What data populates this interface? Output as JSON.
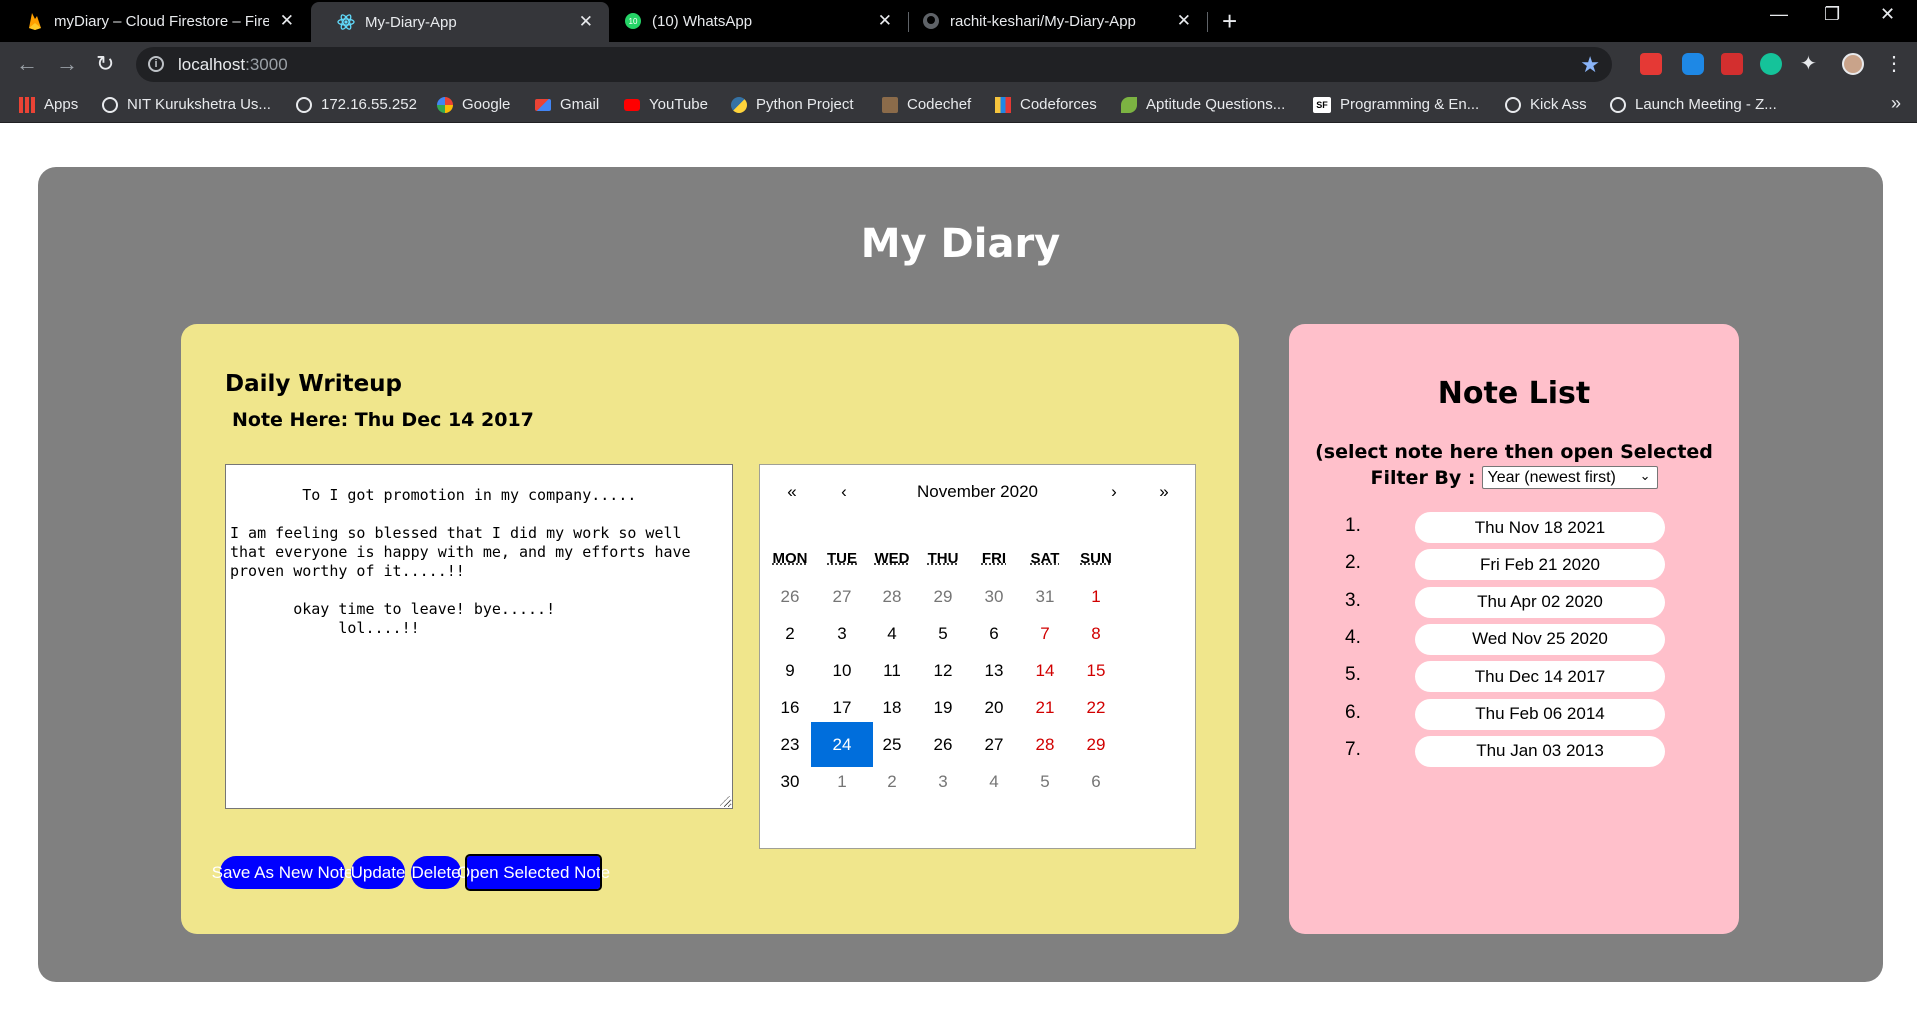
{
  "browser": {
    "tabs": [
      {
        "title": "myDiary – Cloud Firestore – Fireb",
        "icon": "firebase-icon",
        "active": false
      },
      {
        "title": "My-Diary-App",
        "icon": "react-icon",
        "active": true
      },
      {
        "title": "(10) WhatsApp",
        "icon": "whatsapp-icon",
        "active": false
      },
      {
        "title": "rachit-keshari/My-Diary-App",
        "icon": "github-icon",
        "active": false
      }
    ],
    "url_host": "localhost",
    "url_port": ":3000",
    "bookmarks": [
      {
        "label": "Apps",
        "icon": "apps-grid-icon",
        "color": "#ea4335"
      },
      {
        "label": "NIT Kurukshetra Us...",
        "icon": "globe-icon",
        "color": "#e8eaed"
      },
      {
        "label": "172.16.55.252",
        "icon": "globe-icon",
        "color": "#e8eaed"
      },
      {
        "label": "Google",
        "icon": "google-icon",
        "color": "#4285f4"
      },
      {
        "label": "Gmail",
        "icon": "gmail-icon",
        "color": "#ea4335"
      },
      {
        "label": "YouTube",
        "icon": "youtube-icon",
        "color": "#ff0000"
      },
      {
        "label": "Python Project",
        "icon": "python-icon",
        "color": "#3572a5"
      },
      {
        "label": "Codechef",
        "icon": "codechef-icon",
        "color": "#8b6b4a"
      },
      {
        "label": "Codeforces",
        "icon": "codeforces-icon",
        "color": "#f6c43d"
      },
      {
        "label": "Aptitude Questions...",
        "icon": "leaf-icon",
        "color": "#7cb342"
      },
      {
        "label": "Programming & En...",
        "icon": "sf-icon",
        "color": "#ffffff"
      },
      {
        "label": "Kick Ass",
        "icon": "globe-icon",
        "color": "#e8eaed"
      },
      {
        "label": "Launch Meeting - Z...",
        "icon": "globe-icon",
        "color": "#e8eaed"
      }
    ]
  },
  "app": {
    "title": "My Diary",
    "daily": {
      "heading": "Daily Writeup",
      "note_here": "Note Here: Thu Dec 14 2017",
      "note_text": "To I got promotion in my company.....\n\nI am feeling so blessed that I did my work so well\nthat everyone is happy with me, and my efforts have\nproven worthy of it.....!!\n\n       okay time to leave! bye.....!\n            lol....!!"
    },
    "calendar": {
      "month_label": "November 2020",
      "nav": {
        "prev2": "«",
        "prev": "‹",
        "next": "›",
        "next2": "»"
      },
      "weekdays": [
        "MON",
        "TUE",
        "WED",
        "THU",
        "FRI",
        "SAT",
        "SUN"
      ],
      "weeks": [
        [
          "26",
          "27",
          "28",
          "29",
          "30",
          "31",
          "1"
        ],
        [
          "2",
          "3",
          "4",
          "5",
          "6",
          "7",
          "8"
        ],
        [
          "9",
          "10",
          "11",
          "12",
          "13",
          "14",
          "15"
        ],
        [
          "16",
          "17",
          "18",
          "19",
          "20",
          "21",
          "22"
        ],
        [
          "23",
          "24",
          "25",
          "26",
          "27",
          "28",
          "29"
        ],
        [
          "30",
          "1",
          "2",
          "3",
          "4",
          "5",
          "6"
        ]
      ],
      "selected_day": "24"
    },
    "buttons": {
      "save_new": "Save As New Note",
      "update": "Update",
      "delete": "Delete",
      "open_selected": "Open Selected Note"
    },
    "note_list": {
      "title": "Note List",
      "hint": "(select note here then open Selected note)",
      "filter_label": "Filter By :",
      "filter_value": "Year (newest first)",
      "items": [
        {
          "num": "1.",
          "date": "Thu Nov 18 2021"
        },
        {
          "num": "2.",
          "date": "Fri Feb 21 2020"
        },
        {
          "num": "3.",
          "date": "Thu Apr 02 2020"
        },
        {
          "num": "4.",
          "date": "Wed Nov 25 2020"
        },
        {
          "num": "5.",
          "date": "Thu Dec 14 2017"
        },
        {
          "num": "6.",
          "date": "Thu Feb 06 2014"
        },
        {
          "num": "7.",
          "date": "Thu Jan 03 2013"
        }
      ]
    }
  }
}
